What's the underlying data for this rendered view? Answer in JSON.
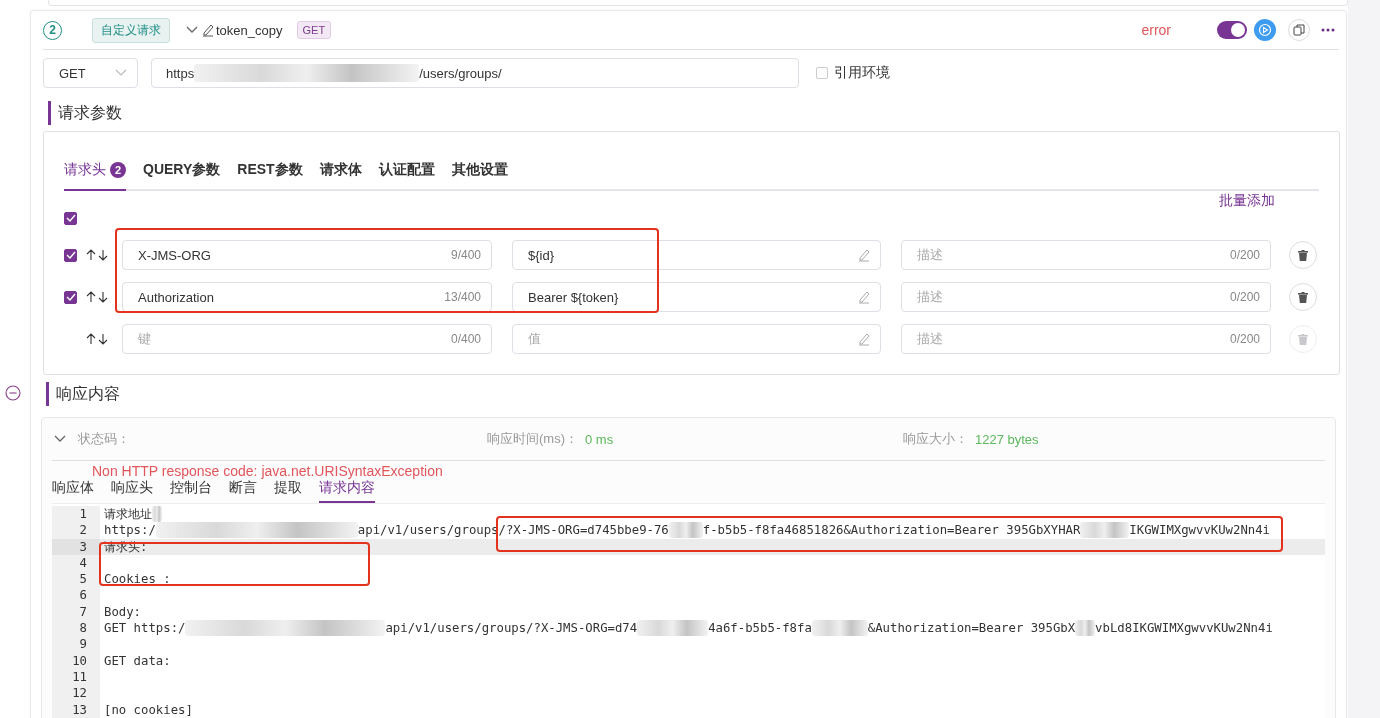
{
  "step": {
    "number": "2",
    "tag": "自定义请求",
    "name": "token_copy",
    "method_badge": "GET",
    "status": "error",
    "enabled": {
      "on": true
    }
  },
  "request": {
    "method": "GET",
    "url_parts": [
      {
        "text": "https"
      },
      {
        "kind": "redacted"
      },
      {
        "text": "/users/groups/"
      }
    ],
    "use_env": {
      "label": "引用环境",
      "checked": false
    }
  },
  "params_title": "请求参数",
  "params_tabs": [
    {
      "label": "请求头",
      "badge": "2",
      "selected": true
    },
    {
      "label": "QUERY参数",
      "selected": false
    },
    {
      "label": "REST参数",
      "selected": false
    },
    {
      "label": "请求体",
      "selected": false
    },
    {
      "label": "认证配置",
      "selected": false
    },
    {
      "label": "其他设置",
      "selected": false
    }
  ],
  "bulk_add": "批量添加",
  "select_all": {
    "checked": true
  },
  "headers": [
    {
      "checked": true,
      "key": "X-JMS-ORG",
      "key_count": "9/400",
      "value": "${id}",
      "description_placeholder": "描述",
      "desc_count": "0/200",
      "disabled": false
    },
    {
      "checked": true,
      "key": "Authorization",
      "key_count": "13/400",
      "value": "Bearer ${token}",
      "description_placeholder": "描述",
      "desc_count": "0/200",
      "disabled": false
    },
    {
      "key_placeholder": "键",
      "key_count": "0/400",
      "value_placeholder": "值",
      "description_placeholder": "描述",
      "desc_count": "0/200",
      "disabled": true
    }
  ],
  "response_title": "响应内容",
  "response": {
    "status_label": "状态码：",
    "time_label": "响应时间(ms)：",
    "time_value": "0 ms",
    "size_label": "响应大小：",
    "size_value": "1227 bytes",
    "error": "Non HTTP response code: java.net.URISyntaxException"
  },
  "response_tabs": [
    {
      "label": "响应体",
      "selected": false
    },
    {
      "label": "响应头",
      "selected": false
    },
    {
      "label": "控制台",
      "selected": false
    },
    {
      "label": "断言",
      "selected": false
    },
    {
      "label": "提取",
      "selected": false
    },
    {
      "label": "请求内容",
      "selected": true
    }
  ],
  "code_lines": [
    {
      "number": "1",
      "active": false,
      "parts": [
        {
          "text": "请求地址"
        },
        {
          "kind": "redacted"
        }
      ]
    },
    {
      "number": "2",
      "active": false,
      "parts": [
        {
          "text": "https:/"
        },
        {
          "kind": "redacted"
        },
        {
          "text": "api/v1/users/groups/?X-JMS-ORG=d745bbe9-76"
        },
        {
          "kind": "redacted"
        },
        {
          "text": "f-b5b5-f8fa46851826&Authorization=Bearer 395GbXYHAR"
        },
        {
          "kind": "redacted"
        },
        {
          "text": "IKGWIMXgwvvKUw2Nn4i"
        }
      ]
    },
    {
      "number": "3",
      "active": true,
      "parts": [
        {
          "text": "请求头:"
        }
      ]
    },
    {
      "number": "4",
      "active": false
    },
    {
      "number": "5",
      "active": false,
      "parts": [
        {
          "text": "Cookies :"
        }
      ]
    },
    {
      "number": "6",
      "active": false
    },
    {
      "number": "7",
      "active": false,
      "parts": [
        {
          "text": "Body:"
        }
      ]
    },
    {
      "number": "8",
      "active": false,
      "parts": [
        {
          "text": "GET https:/"
        },
        {
          "kind": "redacted"
        },
        {
          "text": "api/v1/users/groups/?X-JMS-ORG=d74"
        },
        {
          "kind": "redacted"
        },
        {
          "text": "4a6f-b5b5-f8fa"
        },
        {
          "kind": "redacted"
        },
        {
          "text": "&Authorization=Bearer 395GbX"
        },
        {
          "kind": "redacted"
        },
        {
          "text": "vbLd8IKGWIMXgwvvKUw2Nn4i"
        }
      ]
    },
    {
      "number": "9",
      "active": false
    },
    {
      "number": "10",
      "active": false,
      "parts": [
        {
          "text": "GET data:"
        }
      ]
    },
    {
      "number": "11",
      "active": false
    },
    {
      "number": "12",
      "active": false
    },
    {
      "number": "13",
      "active": false,
      "parts": [
        {
          "text": "[no cookies]"
        }
      ]
    }
  ],
  "annotations": [
    {
      "kind": "outline"
    },
    {
      "kind": "outline"
    },
    {
      "kind": "outline"
    }
  ]
}
